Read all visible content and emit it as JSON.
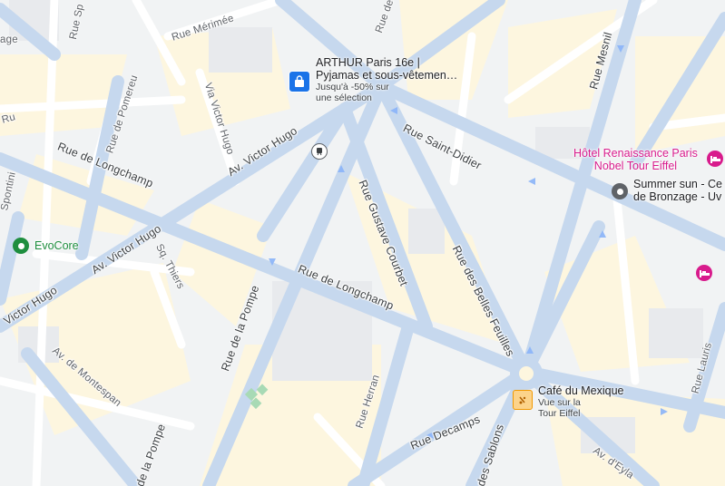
{
  "map": {
    "streets": {
      "rue_sp": "Rue Sp",
      "age": "age",
      "rue_merimee": "Rue Mérimée",
      "rue_de": "Rue de",
      "rue_de_pomereu": "Rue de Pomereu",
      "via_victor_hugo": "Via Victor Hugo",
      "rue_mesnil": "Rue Mesnil",
      "rue_saint_didier": "Rue Saint-Didier",
      "av_victor_hugo_1": "Av. Victor Hugo",
      "av_victor_hugo_2": "Av. Victor Hugo",
      "victor_hugo": "Victor Hugo",
      "rue_de_longchamp_1": "Rue de Longchamp",
      "rue_de_longchamp_2": "Rue de Longchamp",
      "spontini": "Spontini",
      "rue_gustave_courbet": "Rue Gustave Courbet",
      "rue_des_belles_feuilles": "Rue des Belles Feuilles",
      "sq_thiers": "Sq. Thiers",
      "rue_de_la_pompe_1": "Rue de la Pompe",
      "rue_de_la_pompe_2": "de la Pompe",
      "av_de_montespan": "Av. de Montespan",
      "rue_herran": "Rue Herran",
      "rue_decamps": "Rue Decamps",
      "rue_des_sablons": "des Sablons",
      "av_deylau": "Av. d'Eyla",
      "rue_lauris": "Rue Lauris",
      "ru": "Ru"
    },
    "pois": {
      "arthur": {
        "icon": "shopping-bag-icon",
        "title_line1": "ARTHUR Paris 16e |",
        "title_line2": "Pyjamas et sous-vêtemen…",
        "sub_line1": "Jusqu'à -50% sur",
        "sub_line2": "une sélection",
        "color": "#1a73e8"
      },
      "hotel": {
        "icon": "hotel-icon",
        "title_line1": "Hôtel Renaissance Paris",
        "title_line2": "Nobel Tour Eiffel",
        "color": "#d81b8c"
      },
      "summer_sun": {
        "icon": "place-icon",
        "title_line1": "Summer sun - Ce",
        "title_line2": "de Bronzage - Uv",
        "color": "#5f6368"
      },
      "evocore": {
        "icon": "place-icon",
        "title": "EvoCore",
        "color": "#1e8e3e"
      },
      "cafe": {
        "icon": "cafe-icon",
        "title": "Café du Mexique",
        "sub_line1": "Vue sur la",
        "sub_line2": "Tour Eiffel",
        "color": "#f29900"
      },
      "hotel2": {
        "icon": "hotel-icon",
        "color": "#d81b8c"
      },
      "metro": {
        "icon": "metro-icon"
      }
    }
  }
}
